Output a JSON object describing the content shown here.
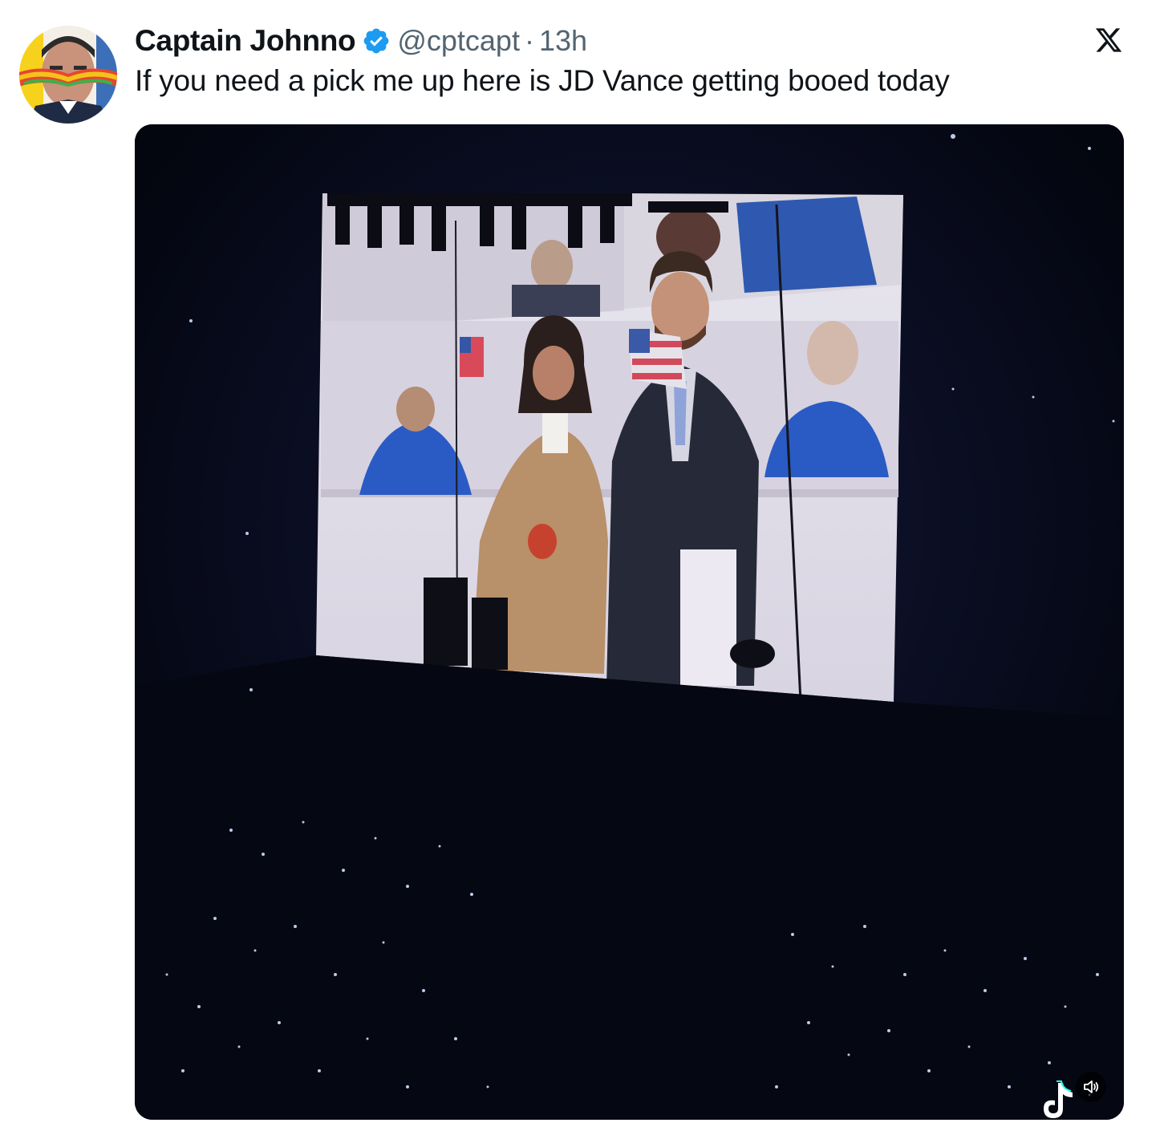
{
  "tweet": {
    "display_name": "Captain Johnno",
    "handle": "@cptcapt",
    "separator": "·",
    "time": "13h",
    "text": "If you need a pick me up here is JD Vance getting booed today"
  },
  "icons": {
    "verified": "verified-badge-icon",
    "platform": "x-logo-icon",
    "mute": "speaker-icon",
    "watermark": "tiktok-icon"
  },
  "colors": {
    "text_primary": "#0f1419",
    "text_secondary": "#536471",
    "verified_blue": "#1d9bf0"
  }
}
